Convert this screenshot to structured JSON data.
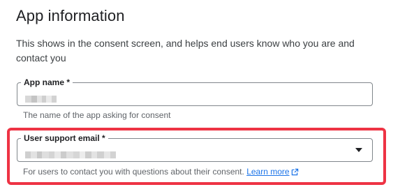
{
  "section": {
    "title": "App information",
    "description": "This shows in the consent screen, and helps end users know who you are and contact you"
  },
  "app_name": {
    "label": "App name *",
    "value_redacted": true,
    "hint": "The name of the app asking for consent"
  },
  "support_email": {
    "label": "User support email *",
    "value_redacted": true,
    "hint": "For users to contact you with questions about their consent.",
    "learn_more": "Learn more"
  },
  "colors": {
    "highlight": "#ee3344",
    "link": "#1a73e8",
    "border": "#80868b"
  }
}
